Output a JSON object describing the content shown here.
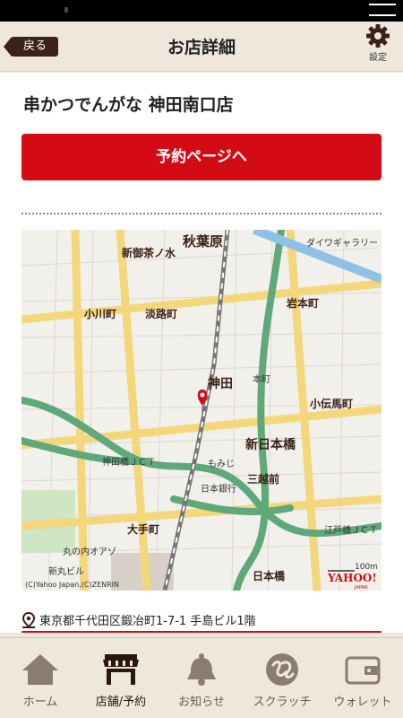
{
  "header": {
    "back_label": "戻る",
    "title": "お店詳細",
    "settings_label": "設定"
  },
  "shop": {
    "name": "串かつでんがな 神田南口店",
    "reserve_label": "予約ページへ",
    "address": "東京都千代田区鍛冶町1-7-1 手島ビル1階"
  },
  "map": {
    "labels": {
      "akihabara": "秋葉原",
      "shin_ochanomizu": "新御茶ノ水",
      "ogawamachi": "小川町",
      "awajicho": "淡路町",
      "iwamotocho": "岩本町",
      "kanda": "神田",
      "kodenmacho": "小伝馬町",
      "shin_nihombashi": "新日本橋",
      "mitsukoshimae": "三越前",
      "otemachi": "大手町",
      "nihombashi": "日本橋",
      "kanda_jct": "神田橋ＪＣＴ",
      "edobashi_jct": "江戸橋ＪＣＴ",
      "daiwa_gallery": "ダイワギャラリー",
      "motomachi": "本町",
      "shin_marunouchi": "新丸ビル",
      "marunouchi_oazo": "丸の内オアゾ",
      "nihon_ginko": "日本銀行",
      "momiji": "もみじ",
      "scale": "100m",
      "copyright": "(C)Yahoo Japan,(C)ZENRIN",
      "yahoo_logo": "YAHOO!",
      "yahoo_sub": "JAPAN"
    },
    "pin_color": "#d30b14"
  },
  "tabs": [
    {
      "label": "ホーム",
      "icon": "home-icon",
      "active": false
    },
    {
      "label": "店舗/予約",
      "icon": "store-icon",
      "active": true
    },
    {
      "label": "お知らせ",
      "icon": "bell-icon",
      "active": false
    },
    {
      "label": "スクラッチ",
      "icon": "scratch-icon",
      "active": false
    },
    {
      "label": "ウォレット",
      "icon": "wallet-icon",
      "active": false
    }
  ],
  "colors": {
    "accent": "#d30b14",
    "brown": "#3a2217",
    "background": "#efe7dc"
  }
}
